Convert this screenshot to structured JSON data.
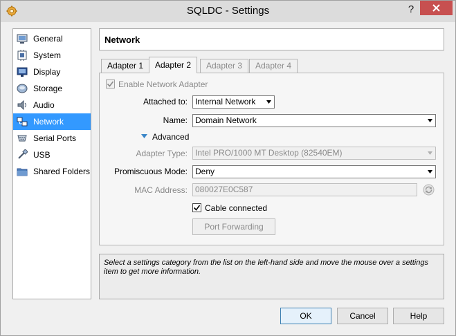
{
  "window": {
    "title": "SQLDC - Settings"
  },
  "titlebar": {
    "help_label": "?"
  },
  "sidebar": {
    "items": [
      {
        "label": "General",
        "icon": "general-icon"
      },
      {
        "label": "System",
        "icon": "system-icon"
      },
      {
        "label": "Display",
        "icon": "display-icon"
      },
      {
        "label": "Storage",
        "icon": "storage-icon"
      },
      {
        "label": "Audio",
        "icon": "audio-icon"
      },
      {
        "label": "Network",
        "icon": "network-icon",
        "selected": true
      },
      {
        "label": "Serial Ports",
        "icon": "serial-ports-icon"
      },
      {
        "label": "USB",
        "icon": "usb-icon"
      },
      {
        "label": "Shared Folders",
        "icon": "shared-folders-icon"
      }
    ]
  },
  "header": {
    "title": "Network"
  },
  "tabs": [
    {
      "label": "Adapter 1"
    },
    {
      "label": "Adapter 2",
      "active": true
    },
    {
      "label": "Adapter 3",
      "disabled": true
    },
    {
      "label": "Adapter 4",
      "disabled": true
    }
  ],
  "adapter": {
    "enable_label": "Enable Network Adapter",
    "enable_checked": true,
    "attached_label": "Attached to:",
    "attached_value": "Internal Network",
    "name_label": "Name:",
    "name_value": "Domain Network",
    "advanced_label": "Advanced",
    "adapter_type_label": "Adapter Type:",
    "adapter_type_value": "Intel PRO/1000 MT Desktop (82540EM)",
    "promiscuous_label": "Promiscuous Mode:",
    "promiscuous_value": "Deny",
    "mac_label": "MAC Address:",
    "mac_value": "080027E0C587",
    "cable_label": "Cable connected",
    "cable_checked": true,
    "port_forwarding_label": "Port Forwarding"
  },
  "info": {
    "text": "Select a settings category from the list on the left-hand side and move the mouse over a settings item to get more information."
  },
  "footer": {
    "ok_label": "OK",
    "cancel_label": "Cancel",
    "help_label": "Help"
  },
  "colors": {
    "selection": "#3399ff",
    "close_button": "#c75050"
  }
}
